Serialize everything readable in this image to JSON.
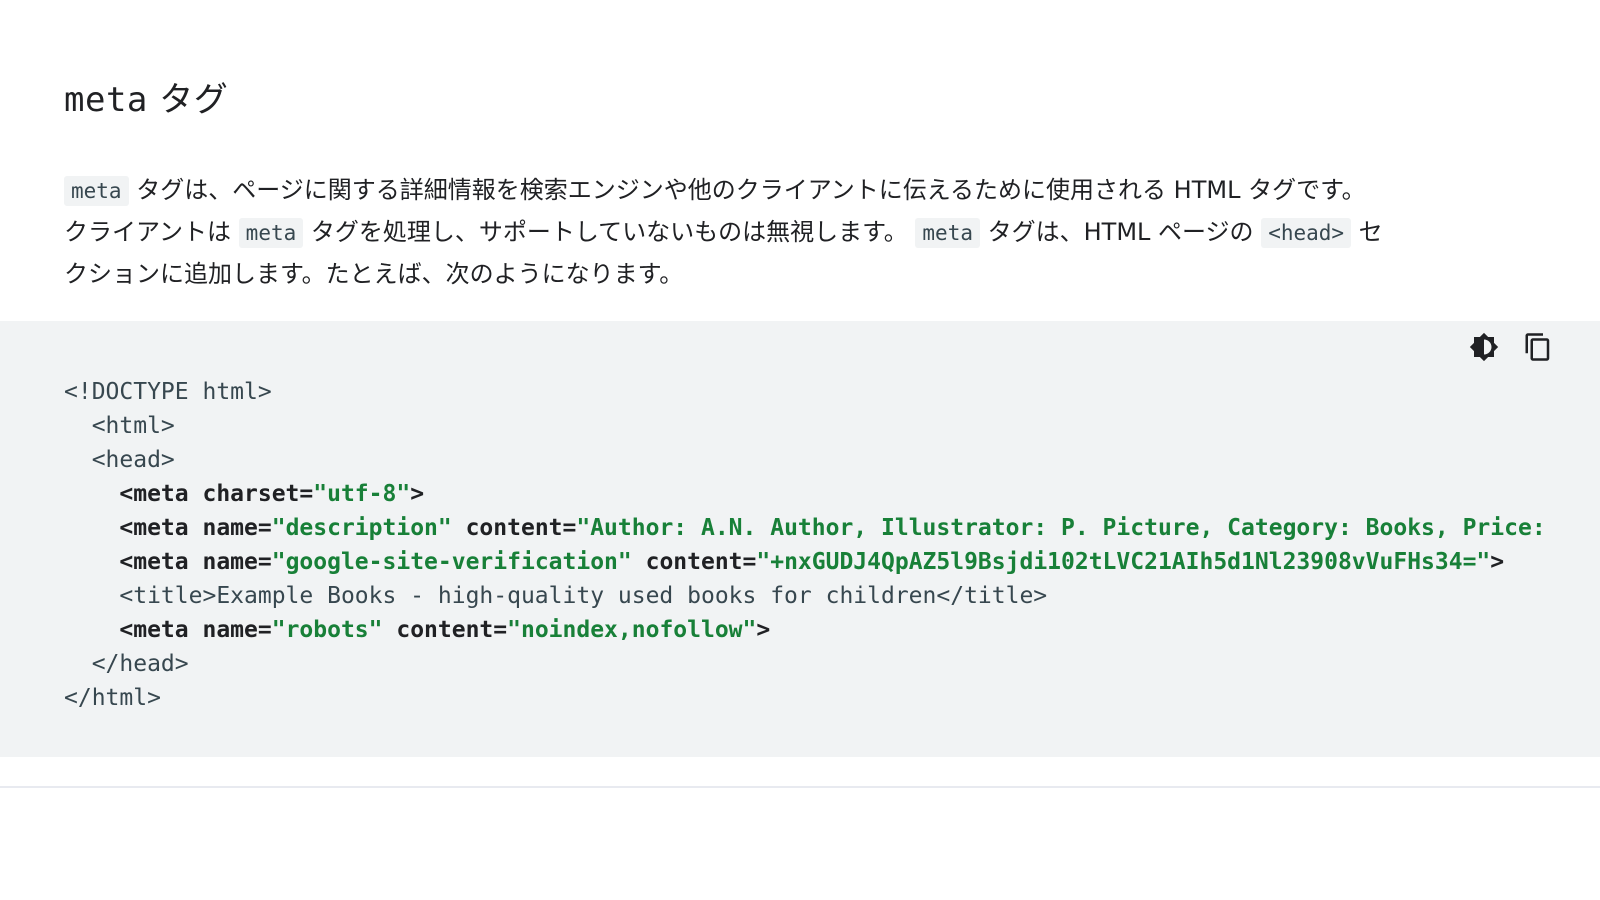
{
  "heading": {
    "code_word": "meta",
    "rest": " タグ"
  },
  "paragraph": {
    "l1_code": "meta",
    "l1_text": " タグは、ページに関する詳細情報を検索エンジンや他のクライアントに伝えるために使用される HTML タグです。",
    "l2_a": "クライアントは ",
    "l2_code1": "meta",
    "l2_b": " タグを処理し、サポートしていないものは無視します。",
    "l2_code2": "meta",
    "l2_c": " タグは、HTML ページの ",
    "l2_code3": "<head>",
    "l2_d": " セ",
    "l3": "クションに追加します。たとえば、次のようになります。"
  },
  "toolbar": {
    "theme_icon": "contrast-icon",
    "copy_icon": "copy-icon"
  },
  "code": {
    "line1": "<!DOCTYPE html>",
    "line2": "  <html>",
    "line3": "  <head>",
    "line4": {
      "indent": "    ",
      "t1": "<meta charset=",
      "s1": "\"utf-8\"",
      "t2": ">"
    },
    "line5": {
      "indent": "    ",
      "t1": "<meta name=",
      "s1": "\"description\"",
      "t2": " content=",
      "s2": "\"Author: A.N. Author, Illustrator: P. Picture, Category: Books, Price:"
    },
    "line6": {
      "indent": "    ",
      "t1": "<meta name=",
      "s1": "\"google-site-verification\"",
      "t2": " content=",
      "s2": "\"+nxGUDJ4QpAZ5l9Bsjdi102tLVC21AIh5d1Nl23908vVuFHs34=\"",
      "t3": ">"
    },
    "line7": "    <title>Example Books - high-quality used books for children</title>",
    "line8": {
      "indent": "    ",
      "t1": "<meta name=",
      "s1": "\"robots\"",
      "t2": " content=",
      "s2": "\"noindex,nofollow\"",
      "t3": ">"
    },
    "line9": "  </head>",
    "line10": "</html>"
  },
  "colors": {
    "code_background": "#f1f3f4",
    "string_green": "#188038",
    "text": "#202124",
    "code_plain": "#37474f"
  }
}
